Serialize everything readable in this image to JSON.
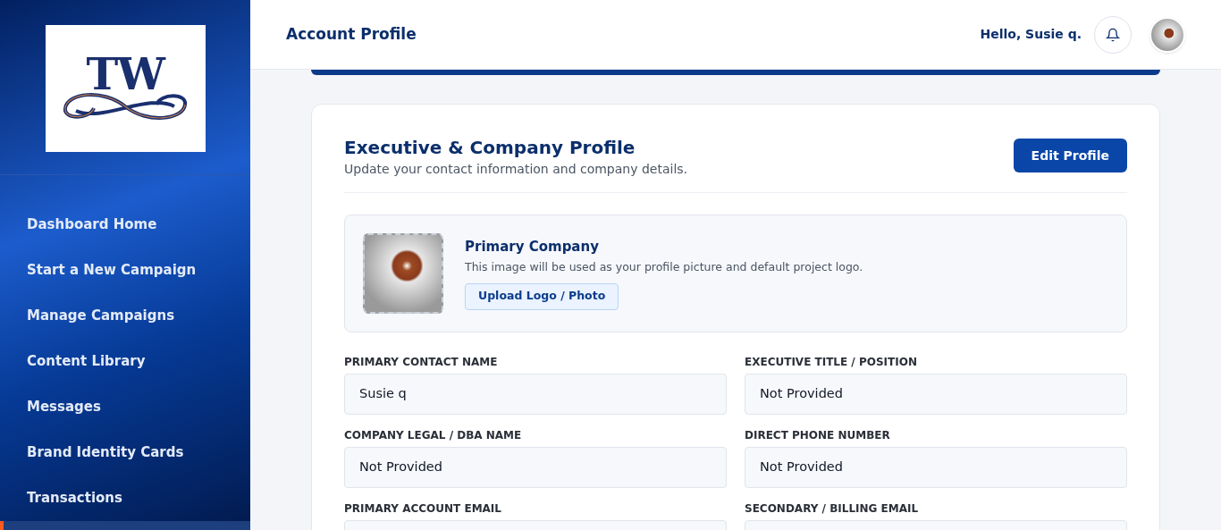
{
  "sidebar": {
    "logo_text": "TW",
    "items": [
      {
        "label": "Dashboard Home",
        "selected": false
      },
      {
        "label": "Start a New Campaign",
        "selected": false
      },
      {
        "label": "Manage Campaigns",
        "selected": false
      },
      {
        "label": "Content Library",
        "selected": false
      },
      {
        "label": "Messages",
        "selected": false
      },
      {
        "label": "Brand Identity Cards",
        "selected": false
      },
      {
        "label": "Transactions",
        "selected": false
      }
    ]
  },
  "header": {
    "title": "Account Profile",
    "greeting": "Hello, Susie q."
  },
  "profile_card": {
    "title": "Executive & Company Profile",
    "subtitle": "Update your contact information and company details.",
    "edit_button": "Edit Profile",
    "company": {
      "name": "Primary Company",
      "description": "This image will be used as your profile picture and default project logo.",
      "upload_button": "Upload Logo / Photo"
    },
    "fields": [
      {
        "label": "PRIMARY CONTACT NAME",
        "value": "Susie q"
      },
      {
        "label": "EXECUTIVE TITLE / POSITION",
        "value": "Not Provided"
      },
      {
        "label": "COMPANY LEGAL / DBA NAME",
        "value": "Not Provided"
      },
      {
        "label": "DIRECT PHONE NUMBER",
        "value": "Not Provided"
      },
      {
        "label": "PRIMARY ACCOUNT EMAIL"
      },
      {
        "label": "SECONDARY / BILLING EMAIL"
      }
    ]
  }
}
